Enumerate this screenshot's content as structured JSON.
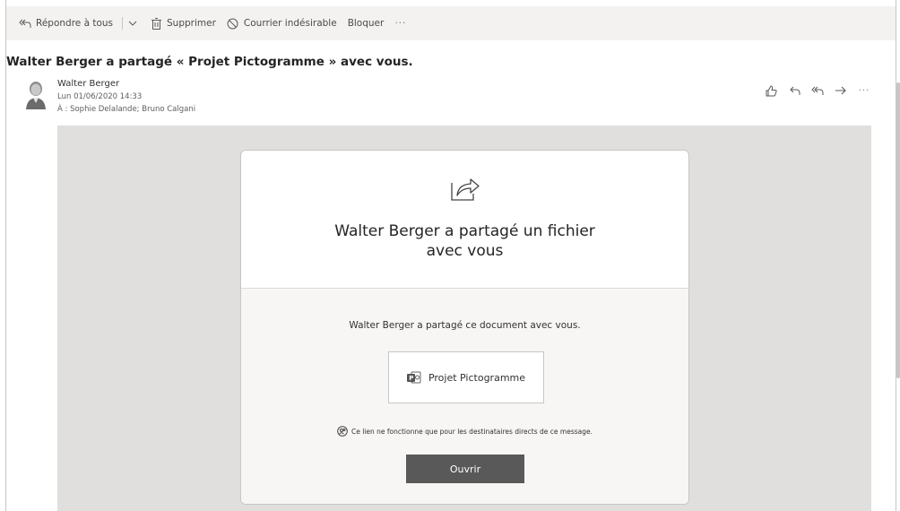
{
  "toolbar": {
    "reply_all": "Répondre à tous",
    "delete": "Supprimer",
    "junk": "Courrier indésirable",
    "block": "Bloquer",
    "more": "···"
  },
  "message": {
    "subject": "Walter Berger a partagé « Projet Pictogramme » avec vous.",
    "sender": "Walter Berger",
    "date": "Lun 01/06/2020 14:33",
    "to": "À : Sophie Delalande; Bruno Calgani",
    "actions": [
      "like-icon",
      "reply-icon",
      "reply-all-icon",
      "forward-icon",
      "more-icon"
    ],
    "more": "···"
  },
  "card": {
    "headline_line1": "Walter Berger a partagé un fichier",
    "headline_line2": "avec vous",
    "message": "Walter Berger a partagé ce document avec vous.",
    "file_name": "Projet Pictogramme",
    "note": "Ce lien ne fonctionne que pour les destinataires directs de ce message.",
    "open_button": "Ouvrir"
  },
  "colors": {
    "toolbar_bg": "#f3f2f1",
    "panel_bg": "#e1dfdd",
    "button_bg": "#595959"
  }
}
